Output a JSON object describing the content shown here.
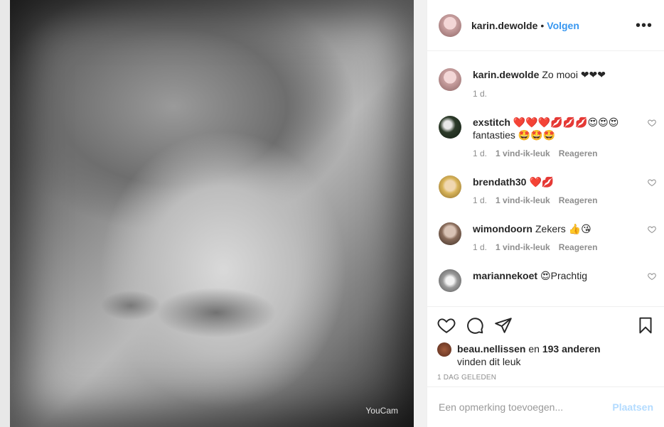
{
  "photo": {
    "watermark": "YouCam"
  },
  "header": {
    "username": "karin.dewolde",
    "dot": "•",
    "follow_label": "Volgen",
    "more_label": "•••"
  },
  "comments": [
    {
      "username": "karin.dewolde",
      "text": "Zo mooi ❤❤❤",
      "time": "1 d.",
      "likes": "",
      "reply": "",
      "avatar_color": "#d9b2b2",
      "has_heart": false
    },
    {
      "username": "exstitch",
      "text": "❤️❤️❤️💋💋💋😍😍😍 fantasties 🤩🤩🤩",
      "time": "1 d.",
      "likes": "1 vind-ik-leuk",
      "reply": "Reageren",
      "avatar_color": "#2d3b2a",
      "has_heart": true
    },
    {
      "username": "brendath30",
      "text": "❤️💋",
      "time": "1 d.",
      "likes": "1 vind-ik-leuk",
      "reply": "Reageren",
      "avatar_color": "#d8b45a",
      "has_heart": true
    },
    {
      "username": "wimondoorn",
      "text": "Zekers 👍😘",
      "time": "1 d.",
      "likes": "1 vind-ik-leuk",
      "reply": "Reageren",
      "avatar_color": "#8a6d5c",
      "has_heart": true
    },
    {
      "username": "mariannekoet",
      "text": "😍Prachtig",
      "time": "",
      "likes": "",
      "reply": "",
      "avatar_color": "#9a9a9a",
      "has_heart": true
    }
  ],
  "likes": {
    "liker": "beau.nellissen",
    "and_text": " en ",
    "others": "193 anderen",
    "suffix": "vinden dit leuk"
  },
  "timestamp": "1 DAG GELEDEN",
  "add_comment": {
    "placeholder": "Een opmerking toevoegen...",
    "post_label": "Plaatsen"
  }
}
